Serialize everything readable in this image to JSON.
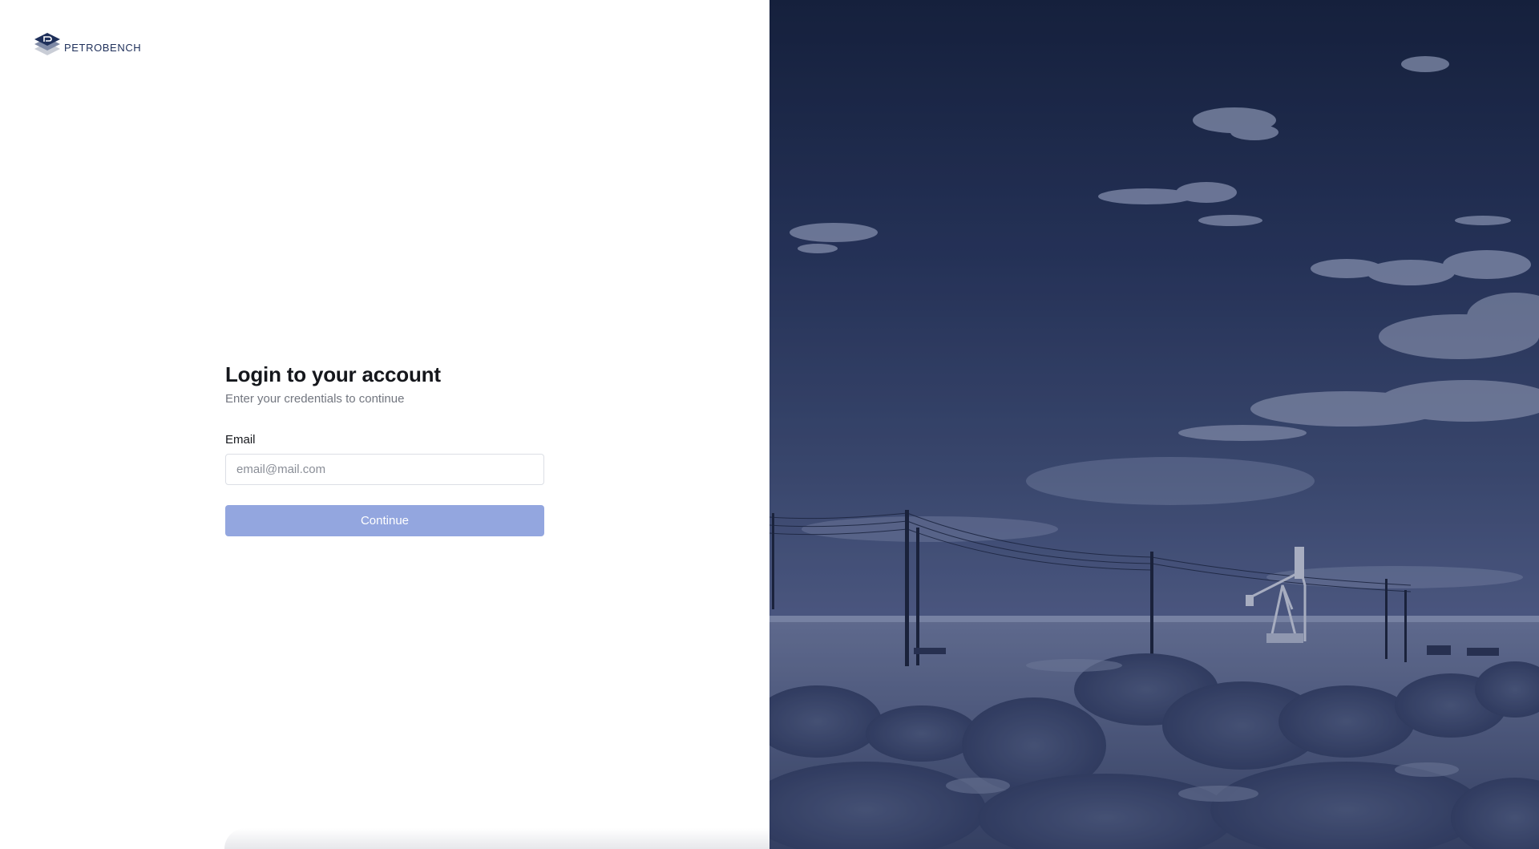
{
  "brand": {
    "name": "PETROBENCH"
  },
  "login": {
    "title": "Login to your account",
    "subtitle": "Enter your credentials to continue",
    "email_label": "Email",
    "email_placeholder": "email@mail.com",
    "email_value": "",
    "continue_label": "Continue"
  },
  "theme": {
    "brand_navy": "#1e2f5a",
    "button_disabled": "#93a6df",
    "hero_overlay": "#1b2748"
  },
  "hero": {
    "image_description_icon": "oilfield-landscape-image"
  }
}
